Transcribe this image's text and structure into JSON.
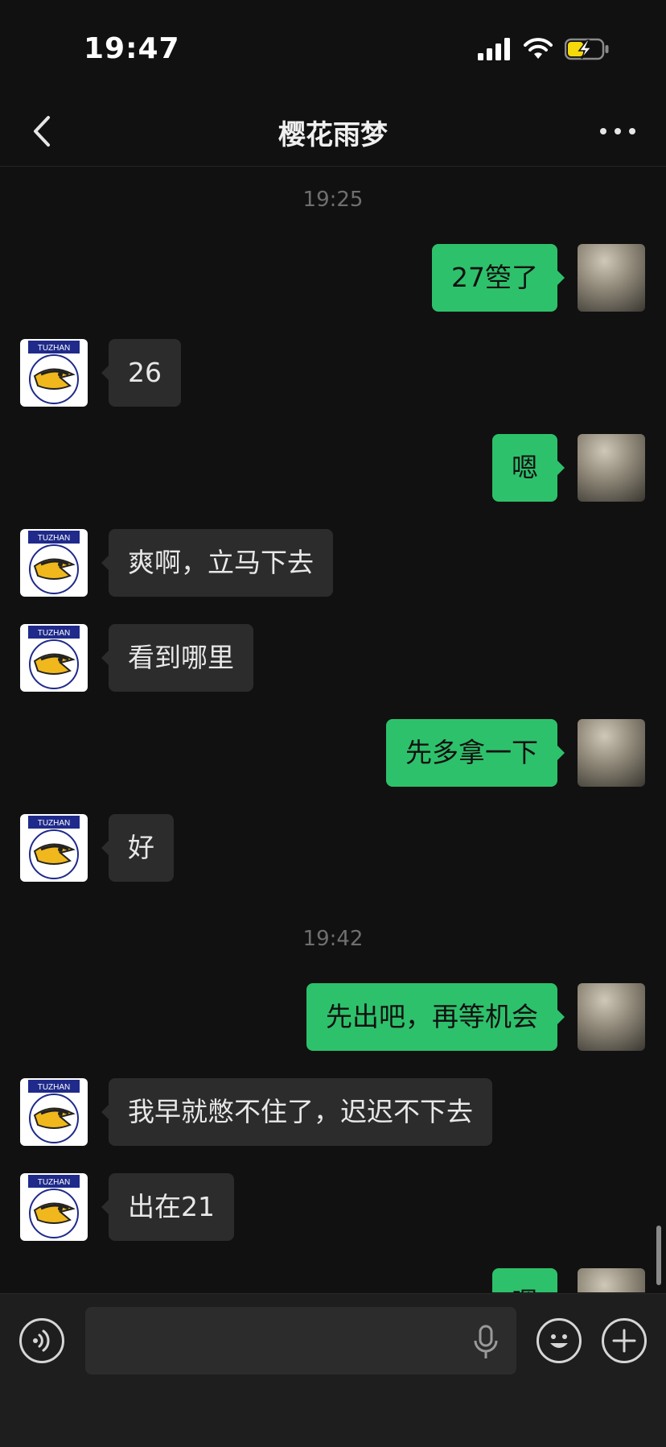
{
  "status_bar": {
    "time": "19:47"
  },
  "header": {
    "title": "樱花雨梦"
  },
  "chat": {
    "timestamps": [
      "19:25",
      "19:42"
    ],
    "messages": [
      {
        "side": "out",
        "text": "27箜了"
      },
      {
        "side": "in",
        "text": "26"
      },
      {
        "side": "out",
        "text": "嗯"
      },
      {
        "side": "in",
        "text": "爽啊，立马下去"
      },
      {
        "side": "in",
        "text": "看到哪里"
      },
      {
        "side": "out",
        "text": "先多拿一下"
      },
      {
        "side": "in",
        "text": "好"
      },
      {
        "side": "out",
        "text": "先出吧，再等机会"
      },
      {
        "side": "in",
        "text": "我早就憋不住了，迟迟不下去"
      },
      {
        "side": "in",
        "text": "出在21"
      },
      {
        "side": "out",
        "text": "嗯"
      }
    ],
    "contact_avatar_label": "TUZHAN"
  },
  "input_bar": {
    "value": "",
    "placeholder": ""
  },
  "icons": {
    "back": "chevron-left-icon",
    "more": "more-dots-icon",
    "voice": "voice-icon",
    "mic": "mic-icon",
    "emoji": "emoji-icon",
    "add": "plus-icon"
  },
  "colors": {
    "background": "#111111",
    "outgoing_bubble": "#2ec16b",
    "incoming_bubble": "#2c2c2c",
    "input_bar": "#1e1e1e"
  }
}
